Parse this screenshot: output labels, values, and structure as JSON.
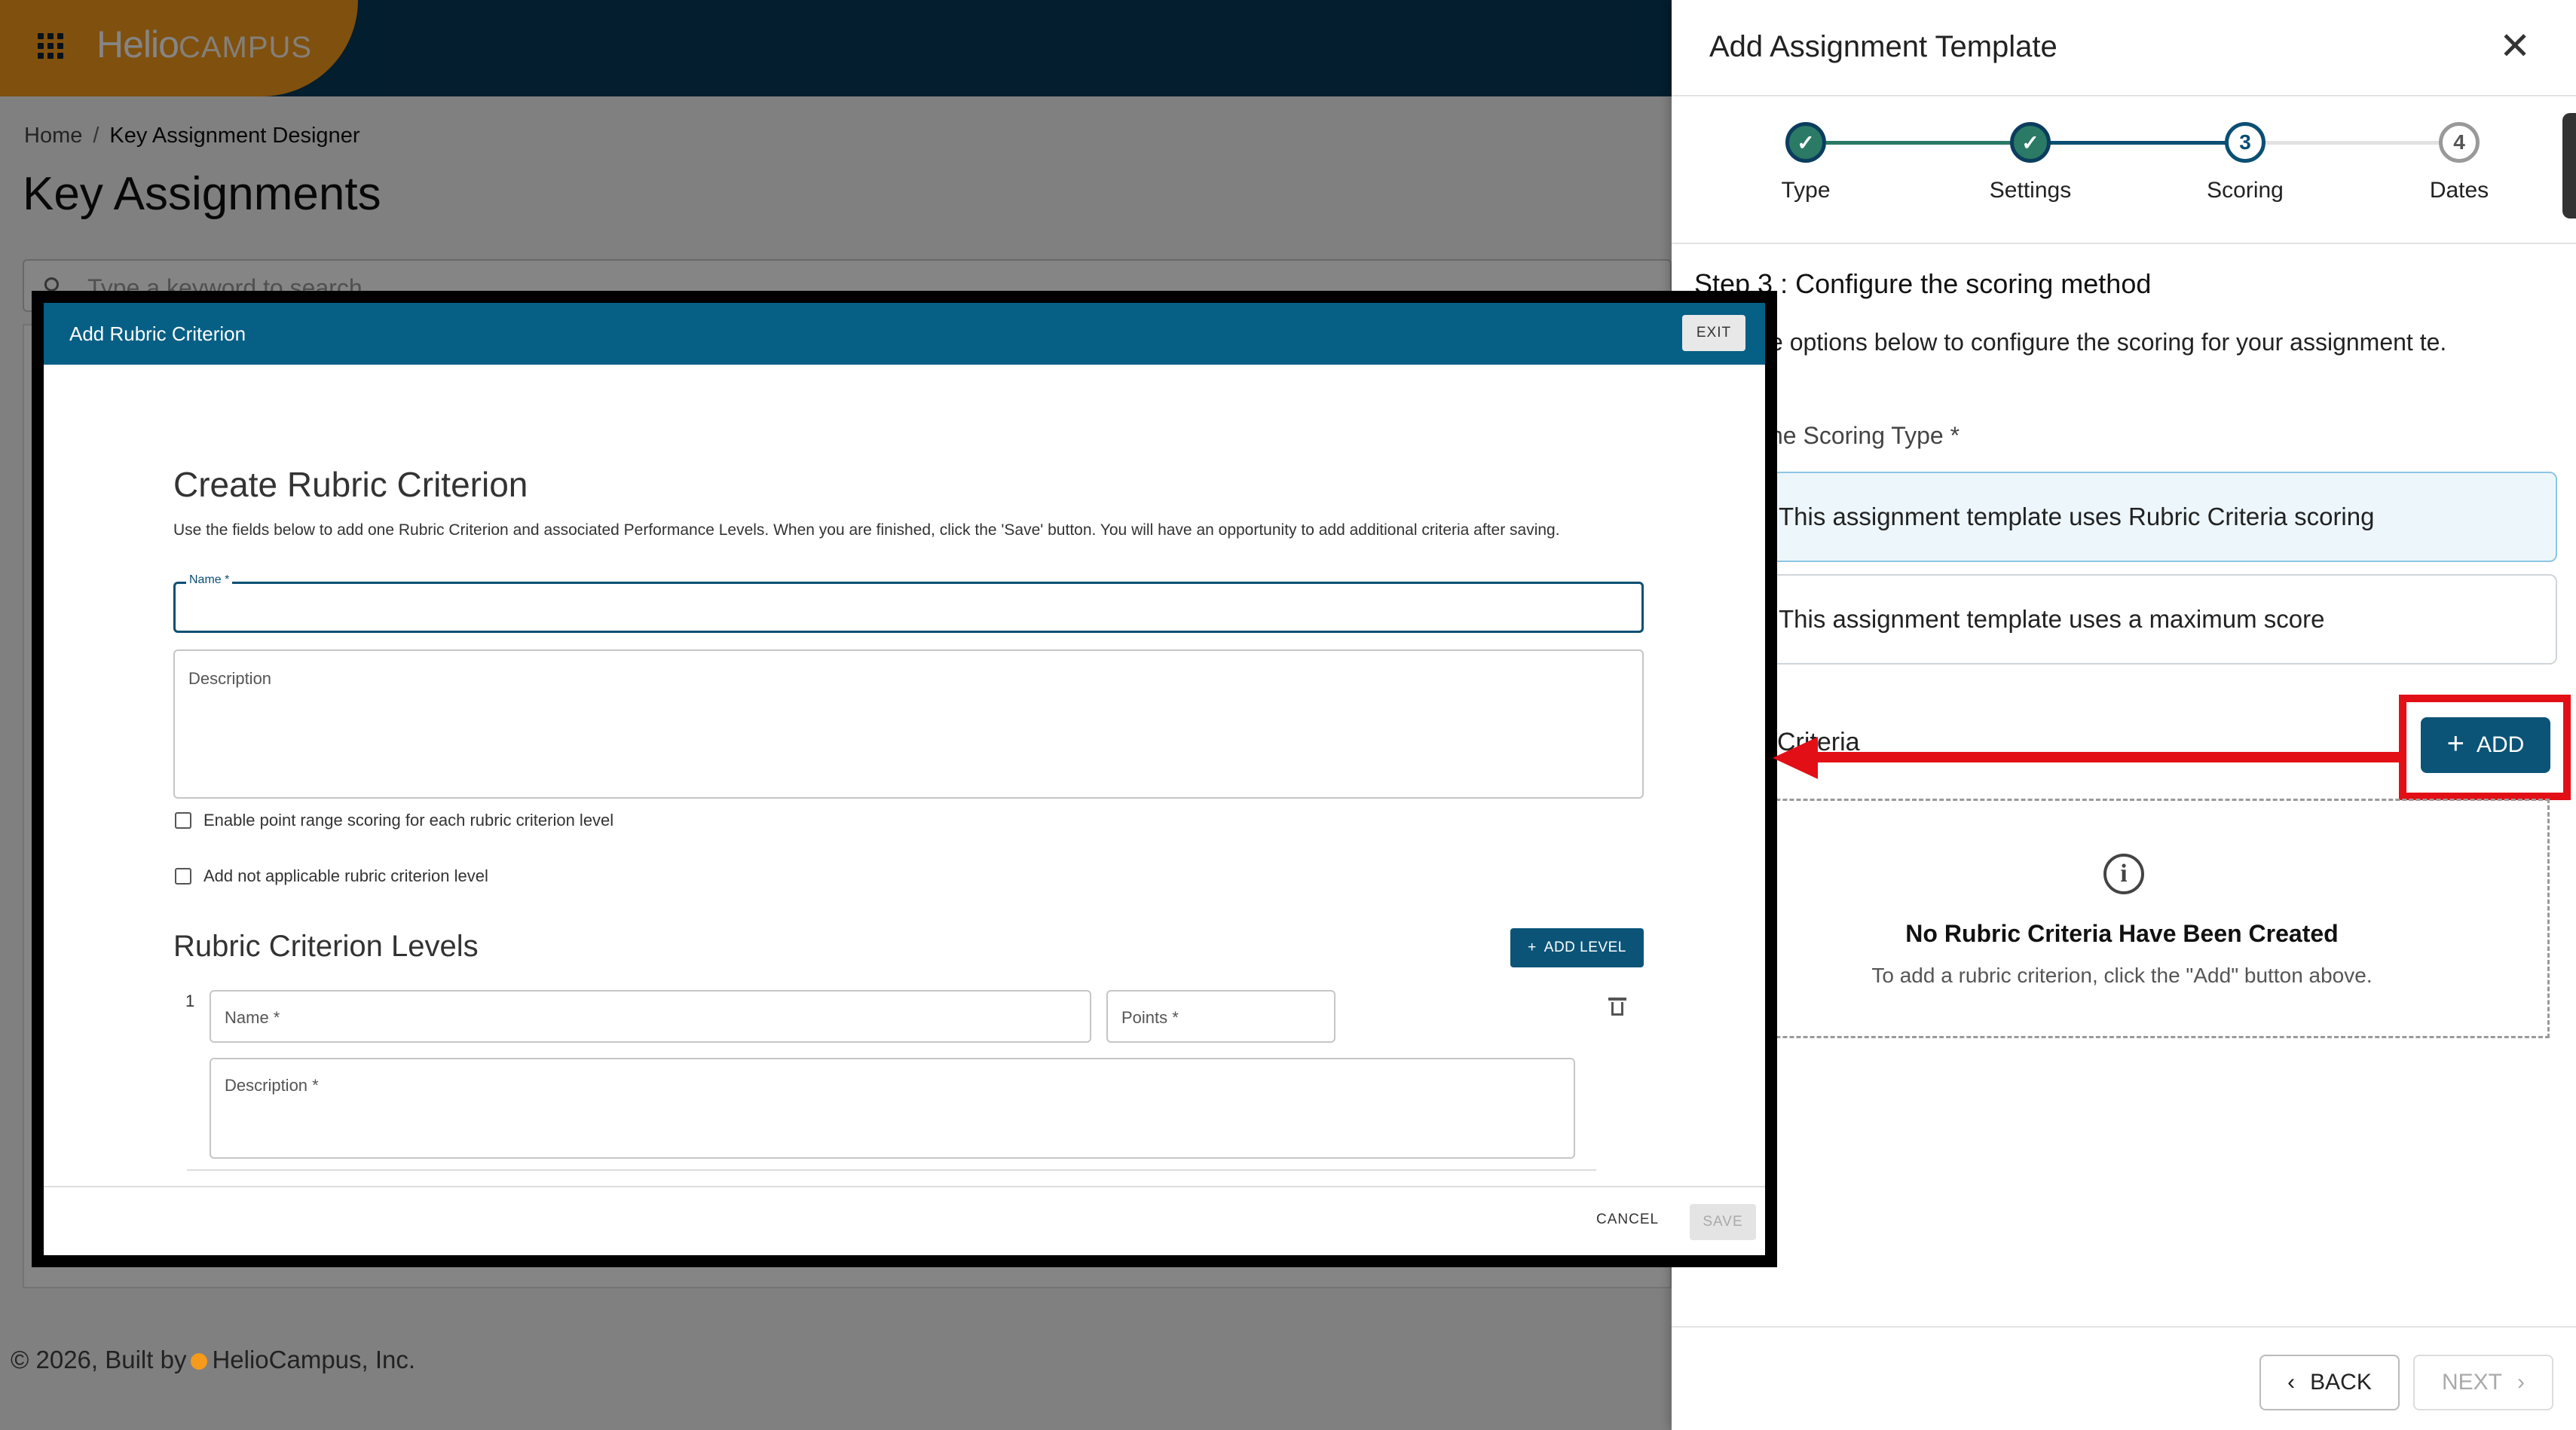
{
  "app": {
    "brand_main": "Helio",
    "brand_sub": "CAMPUS",
    "breadcrumb": {
      "home": "Home",
      "separator": "/",
      "current": "Key Assignment Designer"
    },
    "page_title": "Key Assignments",
    "search_placeholder": "Type a keyword to search",
    "footer": {
      "prefix": "© 2026, Built by",
      "company": "HelioCampus, Inc."
    }
  },
  "drawer": {
    "title": "Add Assignment Template",
    "close_icon": "close-icon",
    "steps": [
      {
        "number": "1",
        "label": "Type",
        "state": "done"
      },
      {
        "number": "2",
        "label": "Settings",
        "state": "done"
      },
      {
        "number": "3",
        "label": "Scoring",
        "state": "active"
      },
      {
        "number": "4",
        "label": "Dates",
        "state": "todo"
      }
    ],
    "step_heading": "Step 3 : Configure the scoring method",
    "description": "e options below to configure the scoring for your assignment te.",
    "scoring_type_label": "he Scoring Type *",
    "options": {
      "rubric": "This assignment template uses Rubric Criteria scoring",
      "max": "This assignment template uses a maximum score"
    },
    "criteria_label": "Criteria",
    "add_button": "ADD",
    "empty": {
      "title": "No Rubric Criteria Have Been Created",
      "subtitle": "To add a rubric criterion, click the \"Add\" button above."
    },
    "back_button": "BACK",
    "next_button": "NEXT"
  },
  "modal": {
    "title": "Add Rubric Criterion",
    "exit_button": "EXIT",
    "heading": "Create Rubric Criterion",
    "description": "Use the fields below to add one Rubric Criterion and associated Performance Levels. When you are finished, click the 'Save' button. You will have an opportunity to add additional criteria after saving.",
    "name_label": "Name *",
    "description_placeholder": "Description",
    "checkbox_point_range": "Enable point range scoring for each rubric criterion level",
    "checkbox_not_applicable": "Add not applicable rubric criterion level",
    "levels_heading": "Rubric Criterion Levels",
    "add_level_button": "ADD LEVEL",
    "level": {
      "number": "1",
      "name_placeholder": "Name *",
      "points_placeholder": "Points *",
      "description_placeholder": "Description *"
    },
    "cancel_button": "CANCEL",
    "save_button": "SAVE"
  },
  "colors": {
    "header_bg": "#073a5a",
    "brand_orange": "#f59a1b",
    "primary": "#0b5478",
    "step_done": "#2a7a66",
    "highlight_red": "#e30f16"
  }
}
